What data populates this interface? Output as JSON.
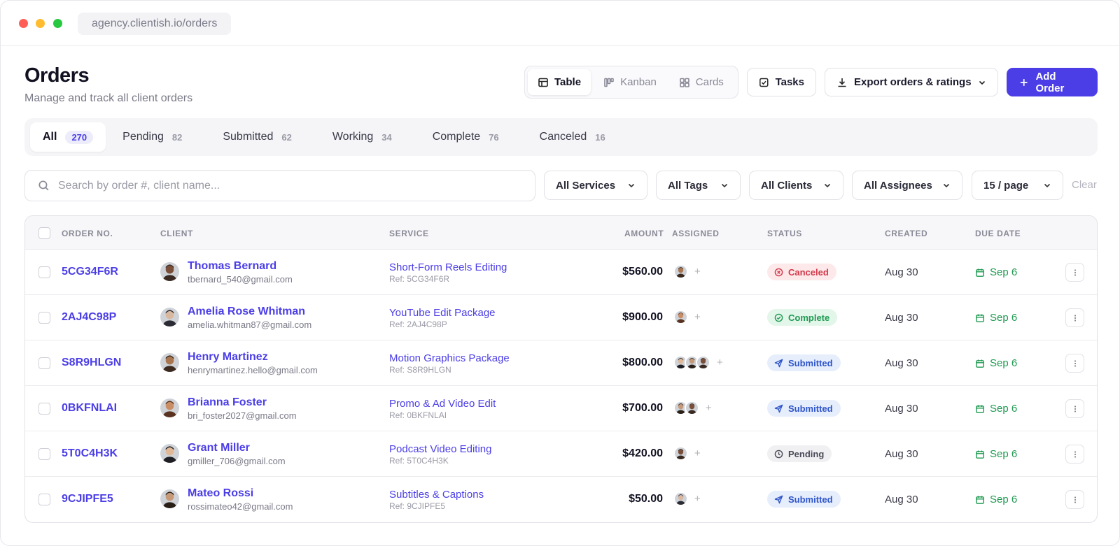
{
  "browser": {
    "url": "agency.clientish.io/orders"
  },
  "header": {
    "title": "Orders",
    "subtitle": "Manage and track all client orders"
  },
  "views": [
    {
      "label": "Table",
      "icon": "table-icon",
      "active": true
    },
    {
      "label": "Kanban",
      "icon": "kanban-icon",
      "active": false
    },
    {
      "label": "Cards",
      "icon": "grid-icon",
      "active": false
    }
  ],
  "actions": {
    "tasks_label": "Tasks",
    "export_label": "Export orders & ratings",
    "add_label": "Add Order"
  },
  "tabs": [
    {
      "label": "All",
      "count": "270",
      "active": true
    },
    {
      "label": "Pending",
      "count": "82"
    },
    {
      "label": "Submitted",
      "count": "62"
    },
    {
      "label": "Working",
      "count": "34"
    },
    {
      "label": "Complete",
      "count": "76"
    },
    {
      "label": "Canceled",
      "count": "16"
    }
  ],
  "filters": {
    "search_placeholder": "Search by order #, client name...",
    "services": "All Services",
    "tags": "All Tags",
    "clients": "All Clients",
    "assignees": "All Assignees",
    "per_page": "15 / page",
    "clear": "Clear"
  },
  "table": {
    "headers": {
      "order": "ORDER NO.",
      "client": "CLIENT",
      "service": "SERVICE",
      "amount": "AMOUNT",
      "assigned": "ASSIGNED",
      "status": "STATUS",
      "created": "CREATED",
      "due": "DUE DATE"
    },
    "rows": [
      {
        "order": "5CG34F6R",
        "client": "Thomas Bernard",
        "email": "tbernard_540@gmail.com",
        "service": "Short-Form Reels Editing",
        "ref": "Ref: 5CG34F6R",
        "amount": "$560.00",
        "assignees": 1,
        "status": "Canceled",
        "status_key": "canceled",
        "created": "Aug 30",
        "due": "Sep 6"
      },
      {
        "order": "2AJ4C98P",
        "client": "Amelia Rose Whitman",
        "email": "amelia.whitman87@gmail.com",
        "service": "YouTube Edit Package",
        "ref": "Ref: 2AJ4C98P",
        "amount": "$900.00",
        "assignees": 1,
        "status": "Complete",
        "status_key": "complete",
        "created": "Aug 30",
        "due": "Sep 6"
      },
      {
        "order": "S8R9HLGN",
        "client": "Henry Martinez",
        "email": "henrymartinez.hello@gmail.com",
        "service": "Motion Graphics Package",
        "ref": "Ref: S8R9HLGN",
        "amount": "$800.00",
        "assignees": 3,
        "status": "Submitted",
        "status_key": "submitted",
        "created": "Aug 30",
        "due": "Sep 6"
      },
      {
        "order": "0BKFNLAI",
        "client": "Brianna Foster",
        "email": "bri_foster2027@gmail.com",
        "service": "Promo & Ad Video Edit",
        "ref": "Ref: 0BKFNLAI",
        "amount": "$700.00",
        "assignees": 2,
        "status": "Submitted",
        "status_key": "submitted",
        "created": "Aug 30",
        "due": "Sep 6"
      },
      {
        "order": "5T0C4H3K",
        "client": "Grant Miller",
        "email": "gmiller_706@gmail.com",
        "service": "Podcast Video Editing",
        "ref": "Ref: 5T0C4H3K",
        "amount": "$420.00",
        "assignees": 1,
        "status": "Pending",
        "status_key": "pending",
        "created": "Aug 30",
        "due": "Sep 6"
      },
      {
        "order": "9CJIPFE5",
        "client": "Mateo Rossi",
        "email": "rossimateo42@gmail.com",
        "service": "Subtitles & Captions",
        "ref": "Ref: 9CJIPFE5",
        "amount": "$50.00",
        "assignees": 1,
        "status": "Submitted",
        "status_key": "submitted",
        "created": "Aug 30",
        "due": "Sep 6"
      }
    ]
  },
  "colors": {
    "accent": "#4b3ee6",
    "canceled": "#d23a4a",
    "complete": "#1f9a52",
    "submitted": "#2f55c9",
    "pending": "#4a4a58"
  }
}
